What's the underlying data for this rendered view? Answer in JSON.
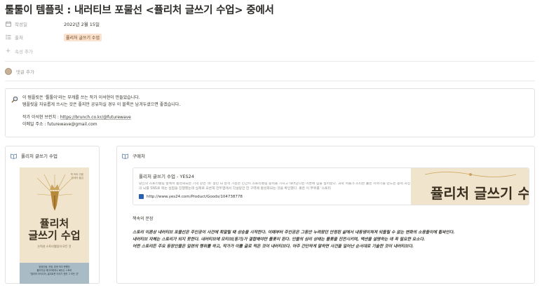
{
  "page": {
    "title": "툴툴이 템플릿 : 내러티브 포물선 <퓰리처 글쓰기 수업> 중에서"
  },
  "properties": [
    {
      "icon": "calendar-icon",
      "label": "작성일",
      "value": "2022년 2월 15일"
    },
    {
      "icon": "list-icon",
      "label": "출처",
      "value": "퓰리처 글쓰기 수업"
    }
  ],
  "add_property": "속성 추가",
  "add_comment": "댓글 추가",
  "callout": {
    "icon": "magnifier-icon",
    "line1": "이 템플릿은 '툴툴이'라는 부캐를 쓰는 작가 이석현이 만들었습니다.",
    "line2": "템플릿을 자유롭게 쓰시는 것은 좋지만 공유하실 경우 이 블록은 남겨두셨으면 좋겠습니다.",
    "line3_label": "작가 이석현 브런치 : ",
    "line3_link": "https://brunch.co.kr/@futurewave",
    "line4": "이메일 주소 : futurewave@gmail.com"
  },
  "left_card": {
    "heading": "퓰리처 글쓰기 수업",
    "cover": {
      "author": "잭 하트 지음",
      "translator": "정세라 옮김",
      "title_line1": "퓰리처",
      "title_line2": "글쓰기 수업",
      "subtitle": "논픽션 스토리텔링의 모든 것",
      "band_line1": "등장인물, 관점, 표현 하지 못했던",
      "band_line2": "퓰리처상 에디터에게서 배우는 스토리",
      "band_line3": "\"필라와 아이디어, 흡미로운 이야기 표현 그 모든 것\""
    }
  },
  "right_card": {
    "heading": "구매처",
    "bookmark": {
      "title": "퓰리처 글쓰기 수업 - YES24",
      "description": "당신의 스토리텔링 방에서 활성화되는 기억 같은 책! 정년 뇌 분석 가운은 인간이 스토리텔링 능력을 가지고 태어난다는 이론에 힘을 실어준다. 과학 저술가 스티븐 홀은 이야기를 만드는 능력 자신의 뇌를 SNS로 찍는 실험을 진행했는데 실제로 오른쪽 전두엽에서 각설탕만 한 구역에 활성화되는 것을 확인했다. 좋은 이 부위를 '스토리",
      "url": "http://www.yes24.com/Product/Goods/104738778",
      "thumb_title": "퓰리처 글쓰기 수업"
    },
    "quote_heading": "책속의 문장",
    "quote_lines": [
      "스토리 이론상 내러티브 포물선은 주인공이 사건에 휘말릴 때 상승을 시작한다. 이때부터 주인공은 그동안 누려왔던 안정된 삶에서 내동댕이쳐져 되돌릴 수 없는 변화의 소용돌이에 휩싸인다.",
      "내러티브 자체는 스토리가 되지 못한다. 내러티브에 모티브(동기)가 결합해야만 플롯이 된다. 인물의 심리 상태는 플롯을 진전시키며, 액션을 설명하는 데 꼭 필요한 요소다.",
      "어떤 스토리든 주요 등장인물은 일련의 행위를 하고, 작가가 이를 글로 적은 것이 내러티브다. 아주 간단하게 말하면 사건을 일어난 순서대로 기술한 것이 내러티브다."
    ]
  },
  "colors": {
    "tag_bg": "#fae3d0",
    "cover_bg": "#f1e4cc",
    "cover_band": "#a9bcc6"
  }
}
